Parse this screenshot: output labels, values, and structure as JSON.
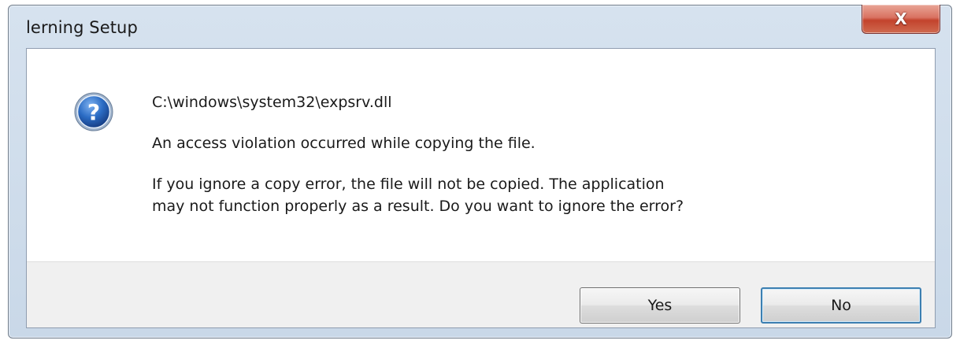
{
  "window": {
    "title": "lerning Setup",
    "close_glyph": "X"
  },
  "dialog": {
    "icon": "question-icon",
    "file_path": "C:\\windows\\system32\\expsrv.dll",
    "message": "An access violation occurred while copying the file.",
    "question_line1": "If you ignore a copy error, the file will not be copied.  The application",
    "question_line2": "may not function properly as a result.  Do you want to ignore the error?"
  },
  "buttons": {
    "yes_label": "Yes",
    "no_label": "No"
  },
  "colors": {
    "icon_blue": "#1f5fb5",
    "close_red": "#c3432d"
  }
}
